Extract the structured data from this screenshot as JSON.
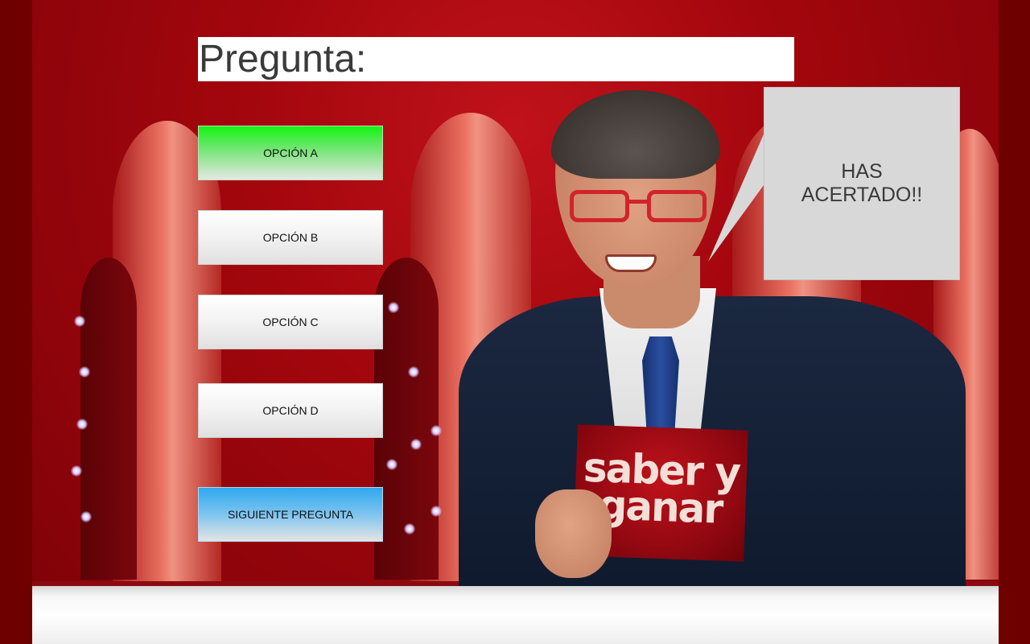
{
  "question": {
    "label": "Pregunta:"
  },
  "options": [
    {
      "label": "OPCIÓN A",
      "state": "correct"
    },
    {
      "label": "OPCIÓN B",
      "state": "neutral"
    },
    {
      "label": "OPCIÓN C",
      "state": "neutral"
    },
    {
      "label": "OPCIÓN D",
      "state": "neutral"
    }
  ],
  "next_button": {
    "label": "SIGUIENTE PREGUNTA"
  },
  "speech_bubble": {
    "line1": "HAS",
    "line2": "ACERTADO!!"
  },
  "host_card": {
    "line1": "saber y",
    "line2": "ganar"
  },
  "colors": {
    "correct": "#14f514",
    "next": "#2fa8ef",
    "stage_red": "#a3060d",
    "bubble": "#d8d8d8"
  }
}
